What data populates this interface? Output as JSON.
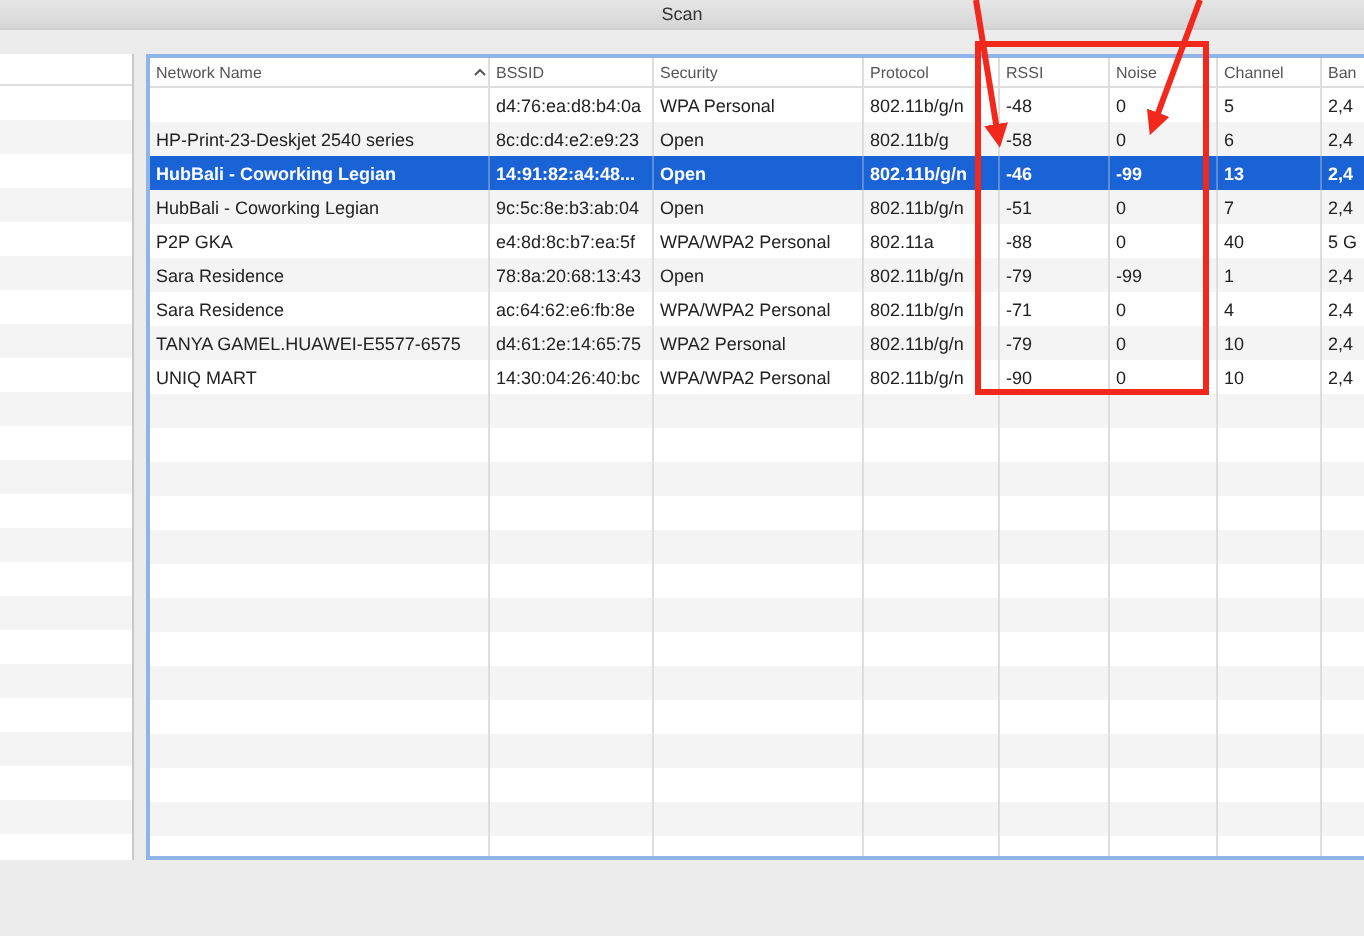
{
  "window": {
    "title": "Scan"
  },
  "table": {
    "columns": [
      {
        "label": "Network Name",
        "sorted": true
      },
      {
        "label": "BSSID",
        "sorted": false
      },
      {
        "label": "Security",
        "sorted": false
      },
      {
        "label": "Protocol",
        "sorted": false
      },
      {
        "label": "RSSI",
        "sorted": false
      },
      {
        "label": "Noise",
        "sorted": false
      },
      {
        "label": "Channel",
        "sorted": false
      },
      {
        "label": "Ban",
        "sorted": false
      }
    ],
    "rows": [
      {
        "selected": false,
        "bssid": "d4:76:ea:d8:b4:0a",
        "security": "WPA Personal",
        "protocol": "802.11b/g/n",
        "rssi": "-48",
        "noise": "0",
        "channel": "5",
        "band": "2,4"
      },
      {
        "selected": false,
        "network_name": "HP-Print-23-Deskjet 2540 series",
        "bssid": "8c:dc:d4:e2:e9:23",
        "security": "Open",
        "protocol": "802.11b/g",
        "rssi": "-58",
        "noise": "0",
        "channel": "6",
        "band": "2,4"
      },
      {
        "selected": true,
        "network_name": "HubBali - Coworking Legian",
        "bssid": "14:91:82:a4:48...",
        "security": "Open",
        "protocol": "802.11b/g/n",
        "rssi": "-46",
        "noise": "-99",
        "channel": "13",
        "band": "2,4"
      },
      {
        "selected": false,
        "network_name": "HubBali - Coworking Legian",
        "bssid": "9c:5c:8e:b3:ab:04",
        "security": "Open",
        "protocol": "802.11b/g/n",
        "rssi": "-51",
        "noise": "0",
        "channel": "7",
        "band": "2,4"
      },
      {
        "selected": false,
        "network_name": "P2P GKA",
        "bssid": "e4:8d:8c:b7:ea:5f",
        "security": "WPA/WPA2 Personal",
        "protocol": "802.11a",
        "rssi": "-88",
        "noise": "0",
        "channel": "40",
        "band": "5 G"
      },
      {
        "selected": false,
        "network_name": "Sara Residence",
        "bssid": "78:8a:20:68:13:43",
        "security": "Open",
        "protocol": "802.11b/g/n",
        "rssi": "-79",
        "noise": "-99",
        "channel": "1",
        "band": "2,4"
      },
      {
        "selected": false,
        "network_name": "Sara Residence",
        "bssid": "ac:64:62:e6:fb:8e",
        "security": "WPA/WPA2 Personal",
        "protocol": "802.11b/g/n",
        "rssi": "-71",
        "noise": "0",
        "channel": "4",
        "band": "2,4"
      },
      {
        "selected": false,
        "network_name": "TANYA GAMEL.HUAWEI-E5577-6575",
        "bssid": "d4:61:2e:14:65:75",
        "security": "WPA2 Personal",
        "protocol": "802.11b/g/n",
        "rssi": "-79",
        "noise": "0",
        "channel": "10",
        "band": "2,4"
      },
      {
        "selected": false,
        "network_name": "UNIQ MART",
        "bssid": "14:30:04:26:40:bc",
        "security": "WPA/WPA2 Personal",
        "protocol": "802.11b/g/n",
        "rssi": "-90",
        "noise": "0",
        "channel": "10",
        "band": "2,4"
      }
    ]
  }
}
